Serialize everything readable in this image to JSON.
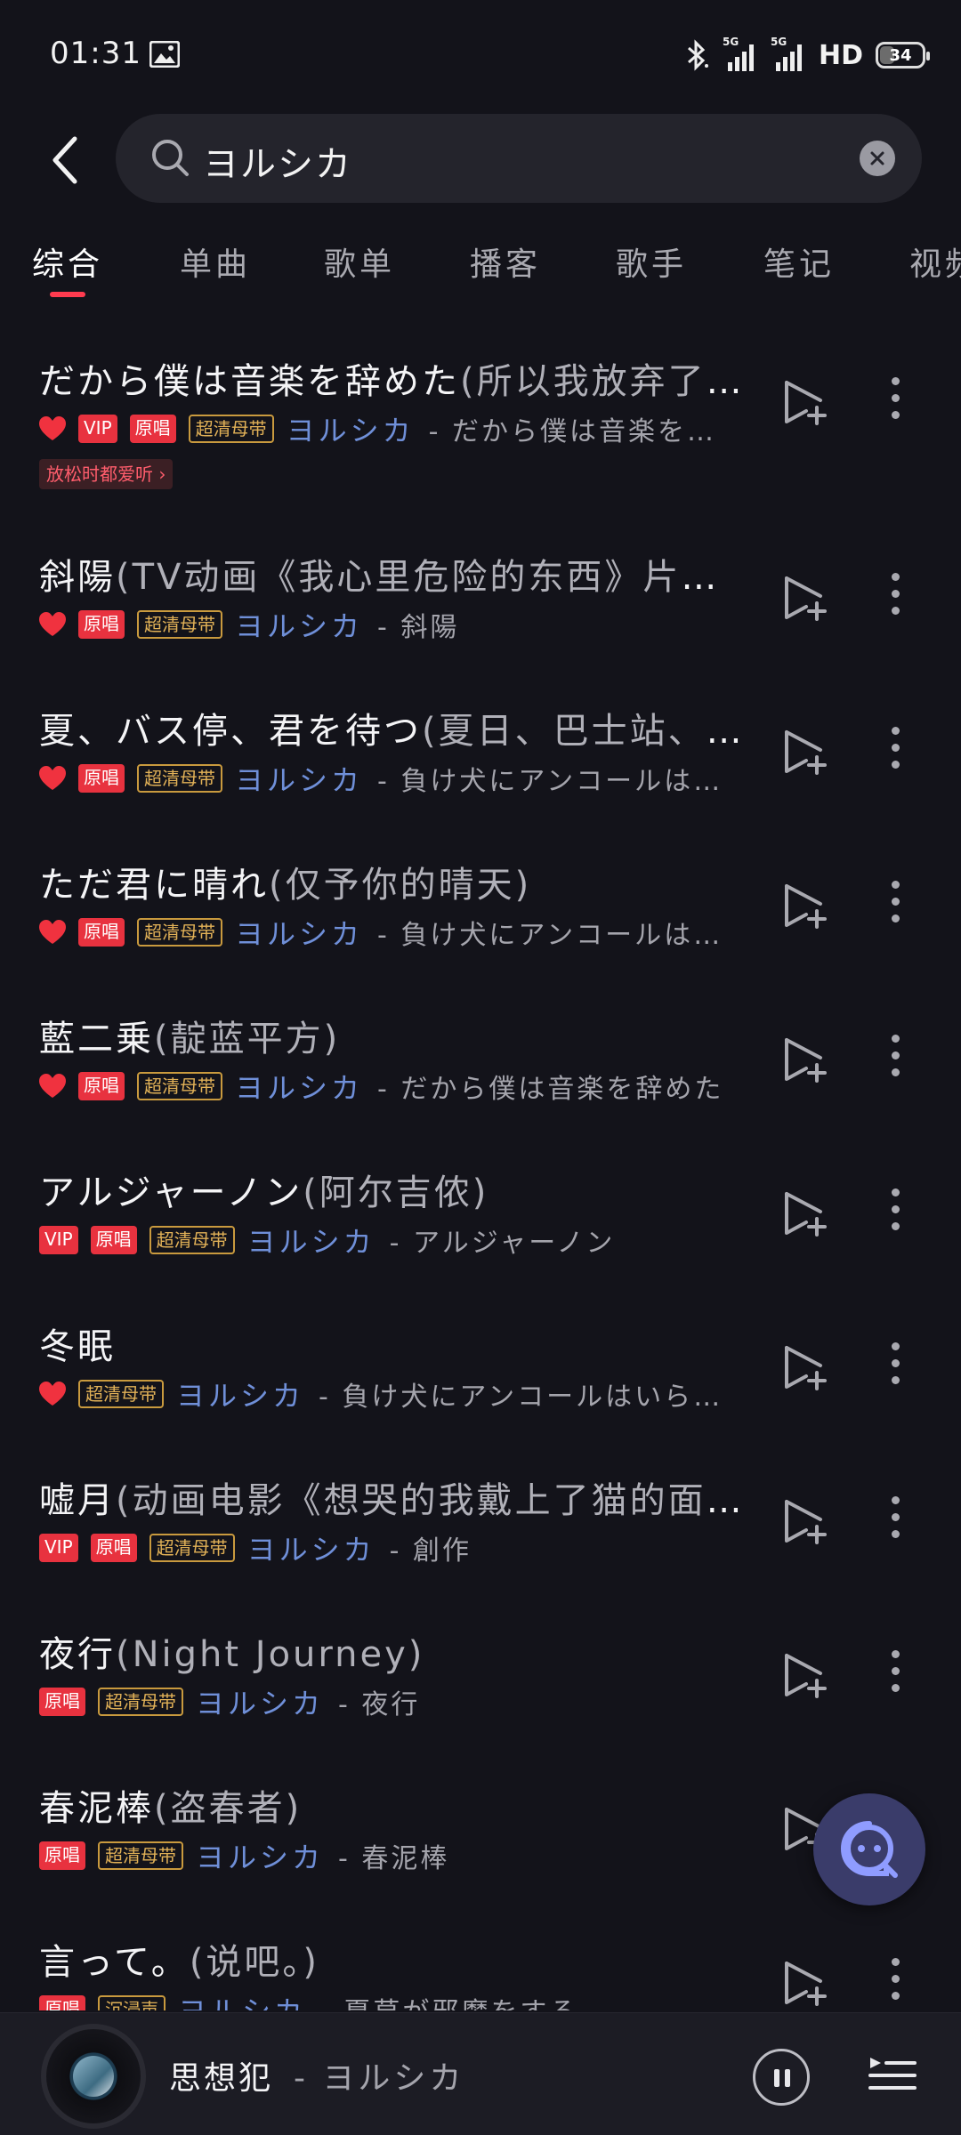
{
  "status": {
    "time": "01:31",
    "hd": "HD",
    "battery": "34",
    "net1": "5G",
    "net2": "5G",
    "battery_level": 0.34
  },
  "search": {
    "query": "ヨルシカ"
  },
  "tabs": [
    {
      "label": "综合",
      "active": true
    },
    {
      "label": "单曲"
    },
    {
      "label": "歌单"
    },
    {
      "label": "播客"
    },
    {
      "label": "歌手"
    },
    {
      "label": "笔记"
    },
    {
      "label": "视频"
    }
  ],
  "songs": [
    {
      "title": "だから僕は音楽を辞めた",
      "sub": "(所以我放弃了音乐)",
      "liked": true,
      "vip": true,
      "original": true,
      "quality": "超清母带",
      "artist": "ヨルシカ",
      "album": "- だから僕は音楽を辞めた",
      "hint": "放松时都爱听 ›"
    },
    {
      "title": "斜陽",
      "sub": "(TV动画《我心里危险的东西》片尾曲)",
      "liked": true,
      "vip": false,
      "original": true,
      "quality": "超清母带",
      "artist": "ヨルシカ",
      "album": "- 斜陽"
    },
    {
      "title": "夏、バス停、君を待つ",
      "sub": "(夏日、巴士站、等你)",
      "liked": true,
      "vip": false,
      "original": true,
      "quality": "超清母带",
      "artist": "ヨルシカ",
      "album": "- 負け犬にアンコールはいらない"
    },
    {
      "title": "ただ君に晴れ",
      "sub": "(仅予你的晴天)",
      "liked": true,
      "vip": false,
      "original": true,
      "quality": "超清母带",
      "artist": "ヨルシカ",
      "album": "- 負け犬にアンコールはいらない"
    },
    {
      "title": "藍二乗",
      "sub": "(靛蓝平方)",
      "liked": true,
      "vip": false,
      "original": true,
      "quality": "超清母带",
      "artist": "ヨルシカ",
      "album": "- だから僕は音楽を辞めた"
    },
    {
      "title": "アルジャーノン",
      "sub": "(阿尔吉侬)",
      "liked": false,
      "vip": true,
      "original": true,
      "quality": "超清母带",
      "artist": "ヨルシカ",
      "album": "- アルジャーノン"
    },
    {
      "title": "冬眠",
      "sub": "",
      "liked": true,
      "vip": false,
      "original": false,
      "quality": "超清母带",
      "artist": "ヨルシカ",
      "album": "- 負け犬にアンコールはいらない"
    },
    {
      "title": "嘘月",
      "sub": "(动画电影《想哭的我戴上了猫的面具》插曲)",
      "liked": false,
      "vip": true,
      "original": true,
      "quality": "超清母带",
      "artist": "ヨルシカ",
      "album": "- 創作"
    },
    {
      "title": "夜行",
      "sub": "(Night Journey)",
      "liked": false,
      "vip": false,
      "original": true,
      "quality": "超清母带",
      "artist": "ヨルシカ",
      "album": "- 夜行"
    },
    {
      "title": "春泥棒",
      "sub": "(盗春者)",
      "liked": false,
      "vip": false,
      "original": true,
      "quality": "超清母带",
      "artist": "ヨルシカ",
      "album": "- 春泥棒"
    },
    {
      "title": "言って。",
      "sub": "(说吧。)",
      "liked": false,
      "vip": false,
      "original": true,
      "quality": "沉浸声",
      "artist": "ヨルシカ",
      "album": "- 夏草が邪魔をする"
    }
  ],
  "labels": {
    "vip": "VIP",
    "original": "原唱"
  },
  "player": {
    "title": "思想犯",
    "artist": "- ヨルシカ"
  },
  "colors": {
    "accent": "#ff3b4f",
    "artist": "#6f8fd8",
    "quality": "#e1b157",
    "badge_red": "#e8323f"
  }
}
